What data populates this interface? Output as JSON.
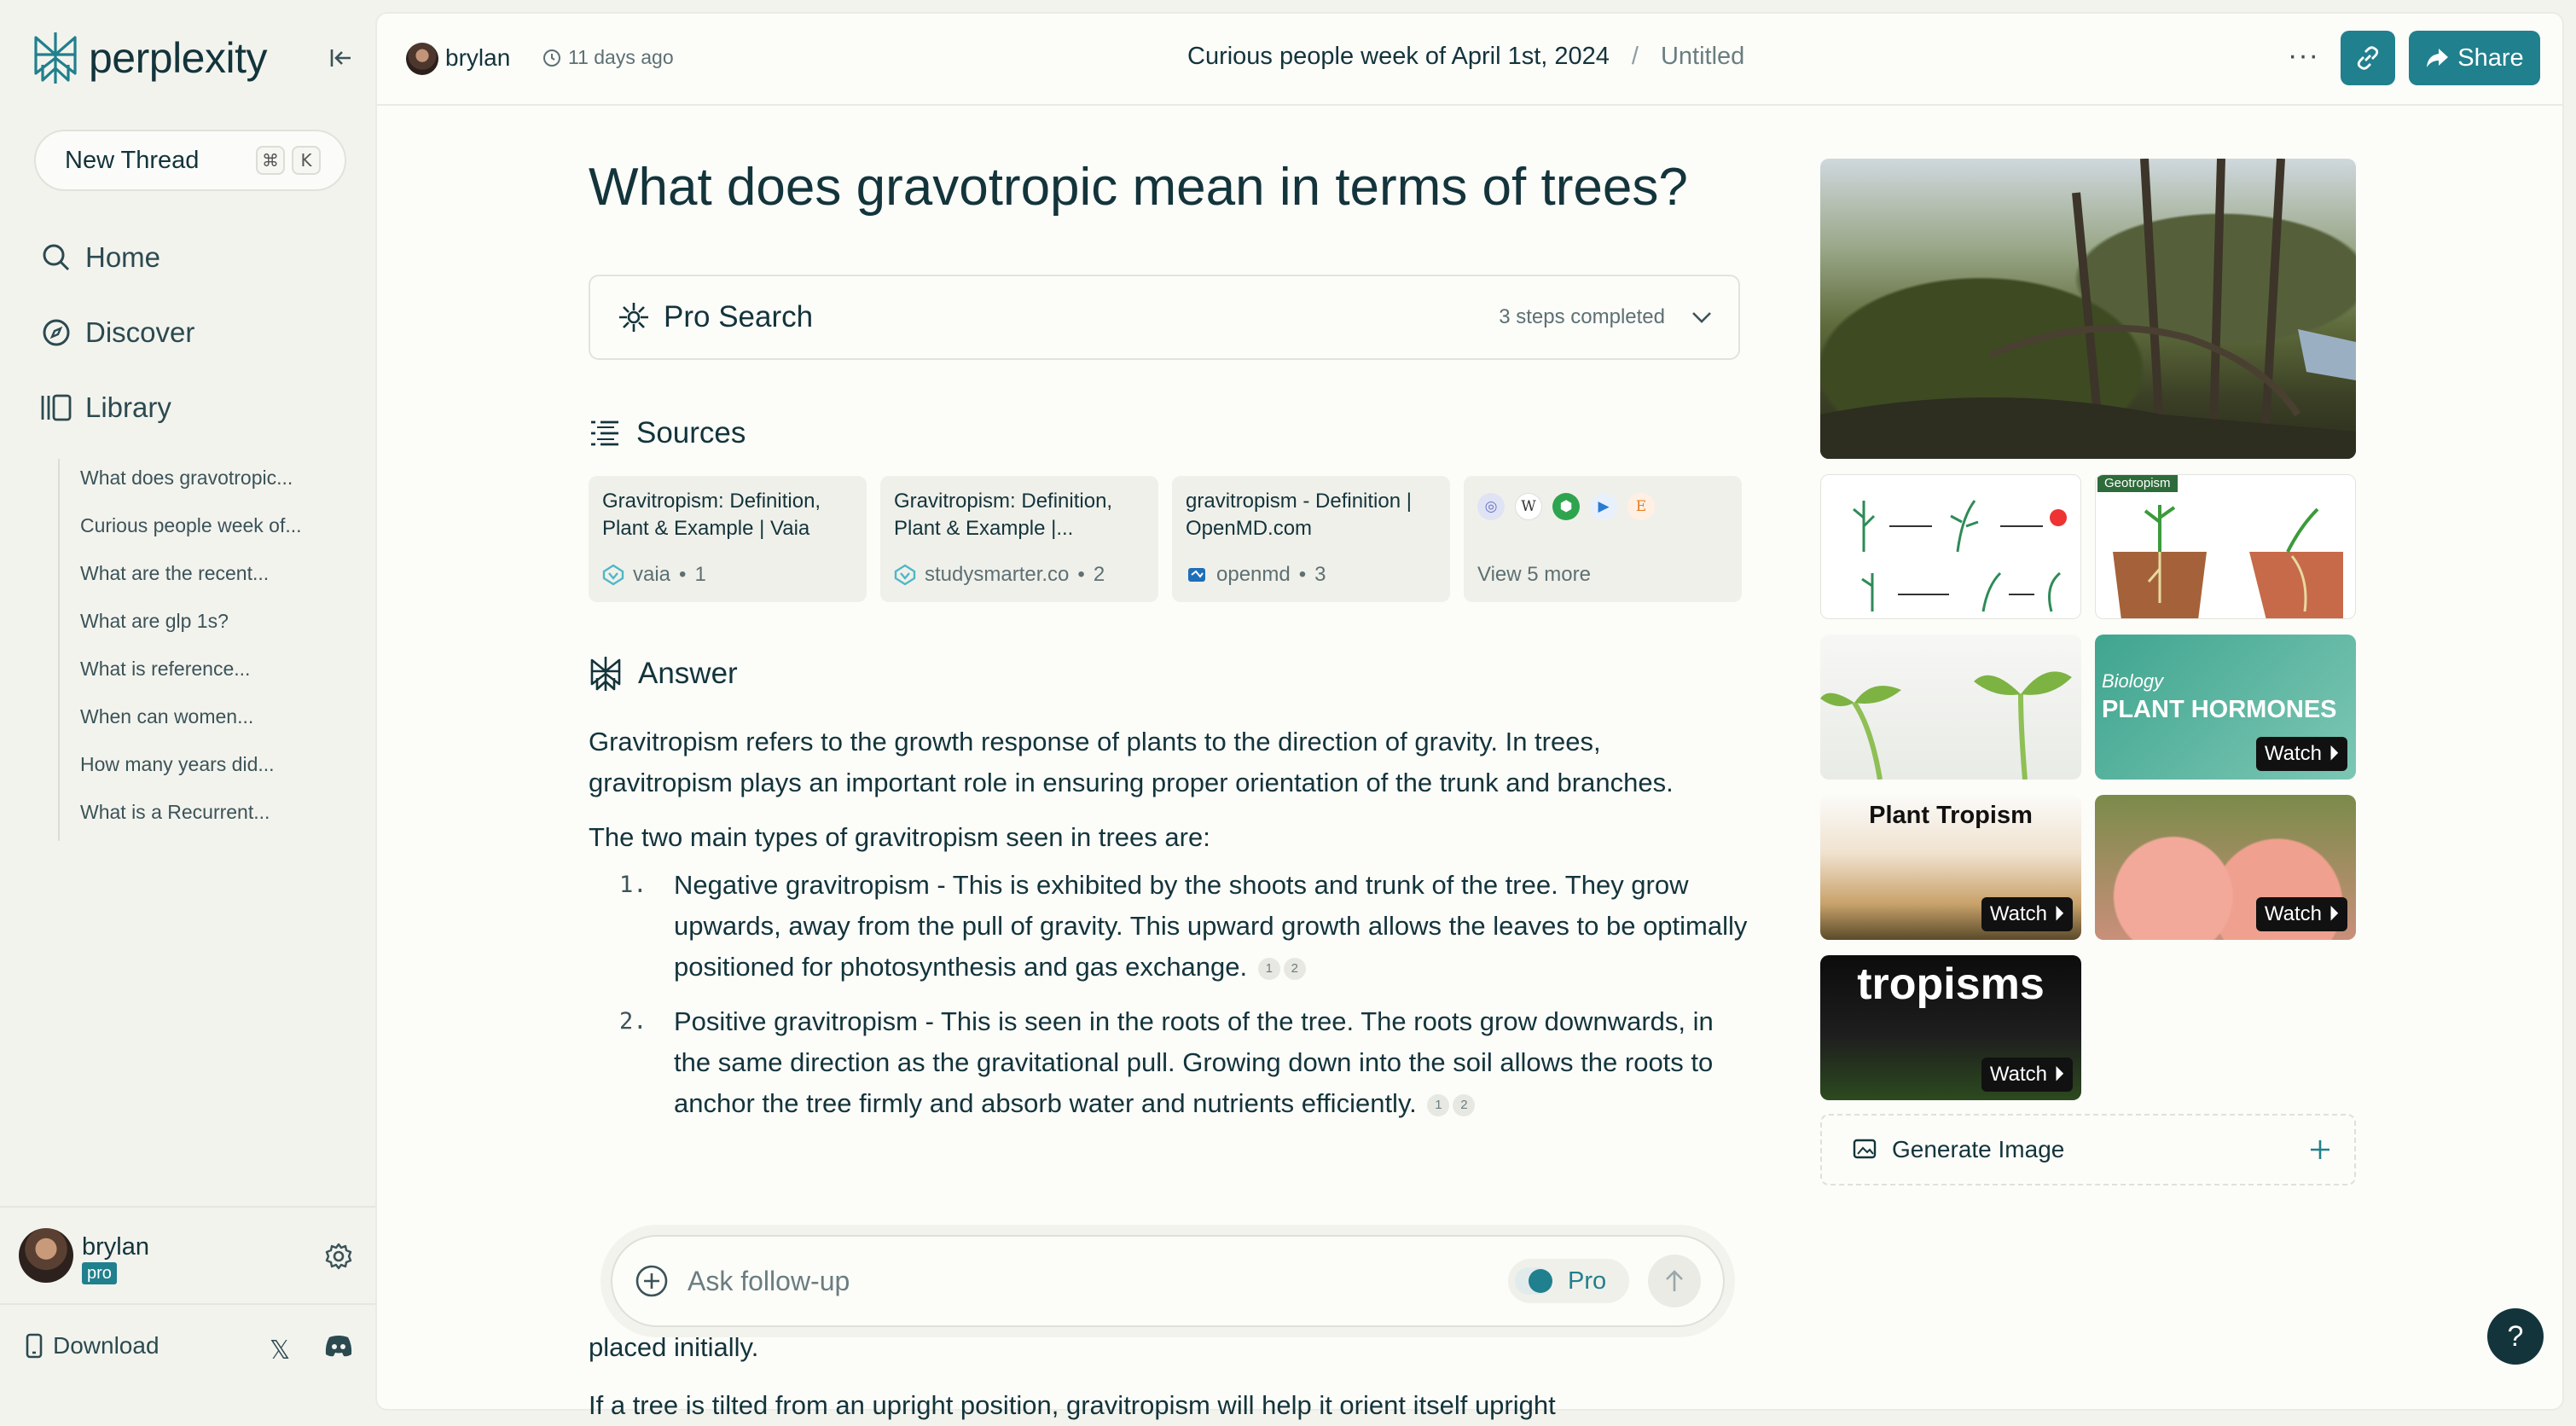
{
  "sidebar": {
    "logo_text": "perplexity",
    "new_thread": {
      "label": "New Thread",
      "key1": "⌘",
      "key2": "K"
    },
    "nav": [
      {
        "label": "Home",
        "icon": "search-icon"
      },
      {
        "label": "Discover",
        "icon": "compass-icon"
      },
      {
        "label": "Library",
        "icon": "library-icon"
      }
    ],
    "library": [
      "What does gravotropic...",
      "Curious people week of...",
      "What are the recent...",
      "What are glp 1s?",
      "What is reference...",
      "When can women...",
      "How many years did...",
      "What is a Recurrent..."
    ],
    "user": {
      "name": "brylan",
      "badge": "pro"
    },
    "download": "Download"
  },
  "topbar": {
    "author": "brylan",
    "time": "11 days ago",
    "collection": "Curious people week of April 1st, 2024",
    "separator": "/",
    "thread_title": "Untitled",
    "more": "···",
    "share": "Share"
  },
  "question": "What does gravotropic mean in terms of trees?",
  "pro_search": {
    "title": "Pro Search",
    "steps": "3 steps completed"
  },
  "sources": {
    "heading": "Sources",
    "items": [
      {
        "title": "Gravitropism: Definition, Plant & Example | Vaia",
        "site": "vaia",
        "num": "1"
      },
      {
        "title": "Gravitropism: Definition, Plant & Example |...",
        "site": "studysmarter.co",
        "num": "2"
      },
      {
        "title": "gravitropism - Definition | OpenMD.com",
        "site": "openmd",
        "num": "3"
      }
    ],
    "view_more": "View 5 more"
  },
  "answer": {
    "heading": "Answer",
    "intro": "Gravitropism refers to the growth response of plants to the direction of gravity. In trees, gravitropism plays an important role in ensuring proper orientation of the trunk and branches.",
    "lead": "The two main types of gravitropism seen in trees are:",
    "items": [
      {
        "num": "1.",
        "text": "Negative gravitropism - This is exhibited by the shoots and trunk of the tree. They grow upwards, away from the pull of gravity. This upward growth allows the leaves to be optimally positioned for photosynthesis and gas exchange.",
        "c1": "1",
        "c2": "2"
      },
      {
        "num": "2.",
        "text": "Positive gravitropism - This is seen in the roots of the tree. The roots grow downwards, in the same direction as the gravitational pull. Growing down into the soil allows the roots to anchor the tree firmly and absorb water and nutrients efficiently.",
        "c1": "1",
        "c2": "2"
      }
    ],
    "partial_1": "placed initially.",
    "partial_2": "If a tree is tilted from an upright position, gravitropism will help it orient itself upright"
  },
  "followup": {
    "placeholder": "Ask follow-up",
    "pro_label": "Pro"
  },
  "media": {
    "tiles": [
      {
        "label": "Geotropism",
        "watch": ""
      },
      {
        "label": "",
        "watch": ""
      },
      {
        "label": "Biology",
        "title": "PLANT HORMONES",
        "watch": "Watch"
      },
      {
        "title": "Plant Tropism",
        "watch": "Watch"
      },
      {
        "title": "",
        "watch": "Watch"
      },
      {
        "title": "tropisms",
        "watch": "Watch"
      }
    ],
    "generate": "Generate Image"
  },
  "help": "?",
  "colors": {
    "accent": "#20808d",
    "text": "#13343b",
    "bg": "#f3f3ee"
  }
}
